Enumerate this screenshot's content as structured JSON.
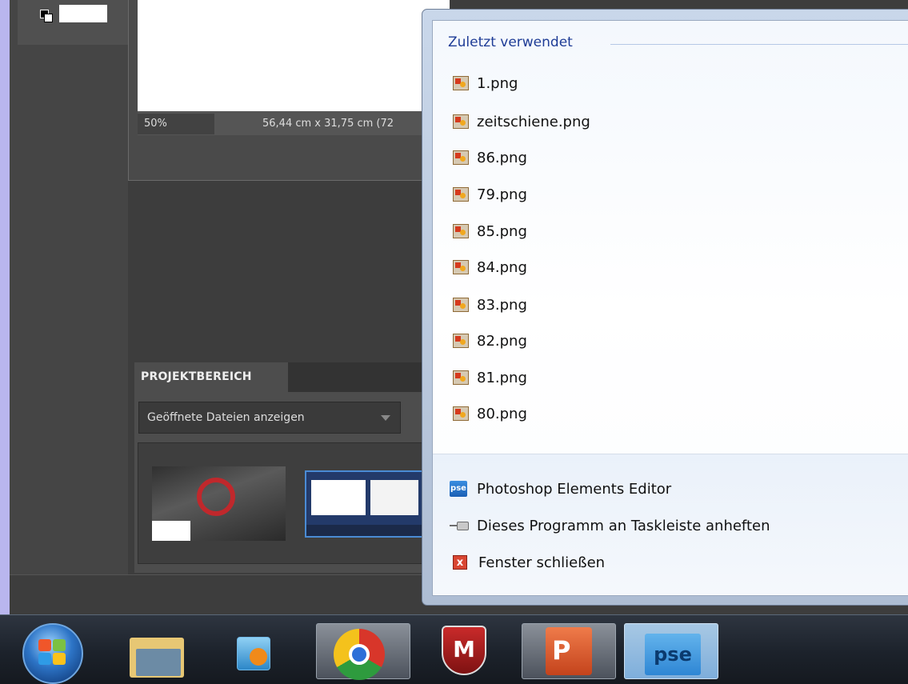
{
  "pse_window": {
    "status_zoom": "50%",
    "status_dimensions": "56,44 cm x 31,75 cm (72",
    "project_panel": {
      "title": "PROJEKTBEREICH",
      "dropdown_value": "Geöffnete Dateien anzeigen"
    }
  },
  "jumplist": {
    "section_title": "Zuletzt verwendet",
    "recent_files": [
      "1.png",
      "zeitschiene.png",
      "86.png",
      "79.png",
      "85.png",
      "84.png",
      "83.png",
      "82.png",
      "81.png",
      "80.png"
    ],
    "tasks": {
      "app_label": "Photoshop Elements Editor",
      "pin_label": "Dieses Programm an Taskleiste anheften",
      "close_label": "Fenster schließen"
    },
    "app_icon_text": "pse",
    "close_icon_text": "x"
  },
  "taskbar": {
    "apps": [
      "start",
      "windows-explorer",
      "media-player",
      "chrome",
      "mcafee",
      "powerpoint",
      "photoshop-elements"
    ],
    "mcafee_text": "M",
    "ppt_text": "P",
    "pse_text": "pse"
  },
  "colors": {
    "jumplist_header": "#1e3c96",
    "pse_panel": "#4d4d4d",
    "desktop": "#b9b6ee"
  }
}
